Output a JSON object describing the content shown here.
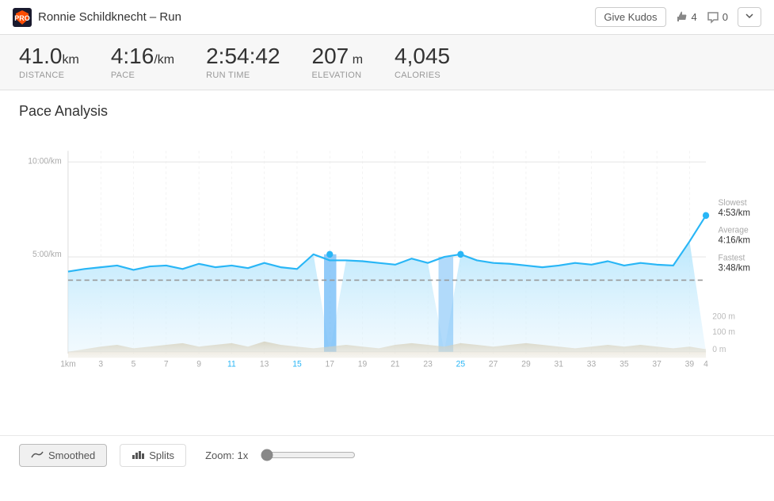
{
  "header": {
    "title": "Ronnie Schildknecht – Run",
    "give_kudos_label": "Give Kudos",
    "kudos_count": "4",
    "comment_count": "0"
  },
  "stats": [
    {
      "value": "41.0",
      "unit": "km",
      "label": "Distance"
    },
    {
      "value": "4:16",
      "unit": "/km",
      "label": "Pace"
    },
    {
      "value": "2:54:42",
      "unit": "",
      "label": "Run Time"
    },
    {
      "value": "207",
      "unit": " m",
      "label": "Elevation"
    },
    {
      "value": "4,045",
      "unit": "",
      "label": "Calories"
    }
  ],
  "chart": {
    "title": "Pace Analysis",
    "y_labels": [
      "10:00/km",
      "5:00/km"
    ],
    "x_labels": [
      "1km",
      "3",
      "5",
      "7",
      "9",
      "11",
      "13",
      "15",
      "17",
      "19",
      "21",
      "23",
      "25",
      "27",
      "29",
      "31",
      "33",
      "35",
      "37",
      "39",
      "4"
    ],
    "right_labels": [
      {
        "label": "Slowest",
        "value": "4:53/km"
      },
      {
        "label": "Average",
        "value": "4:16/km"
      },
      {
        "label": "Fastest",
        "value": "3:48/km"
      }
    ],
    "elevation_labels": [
      "200 m",
      "100 m",
      "0 m"
    ]
  },
  "controls": {
    "smoothed_label": "Smoothed",
    "splits_label": "Splits",
    "zoom_label": "Zoom: 1x"
  }
}
